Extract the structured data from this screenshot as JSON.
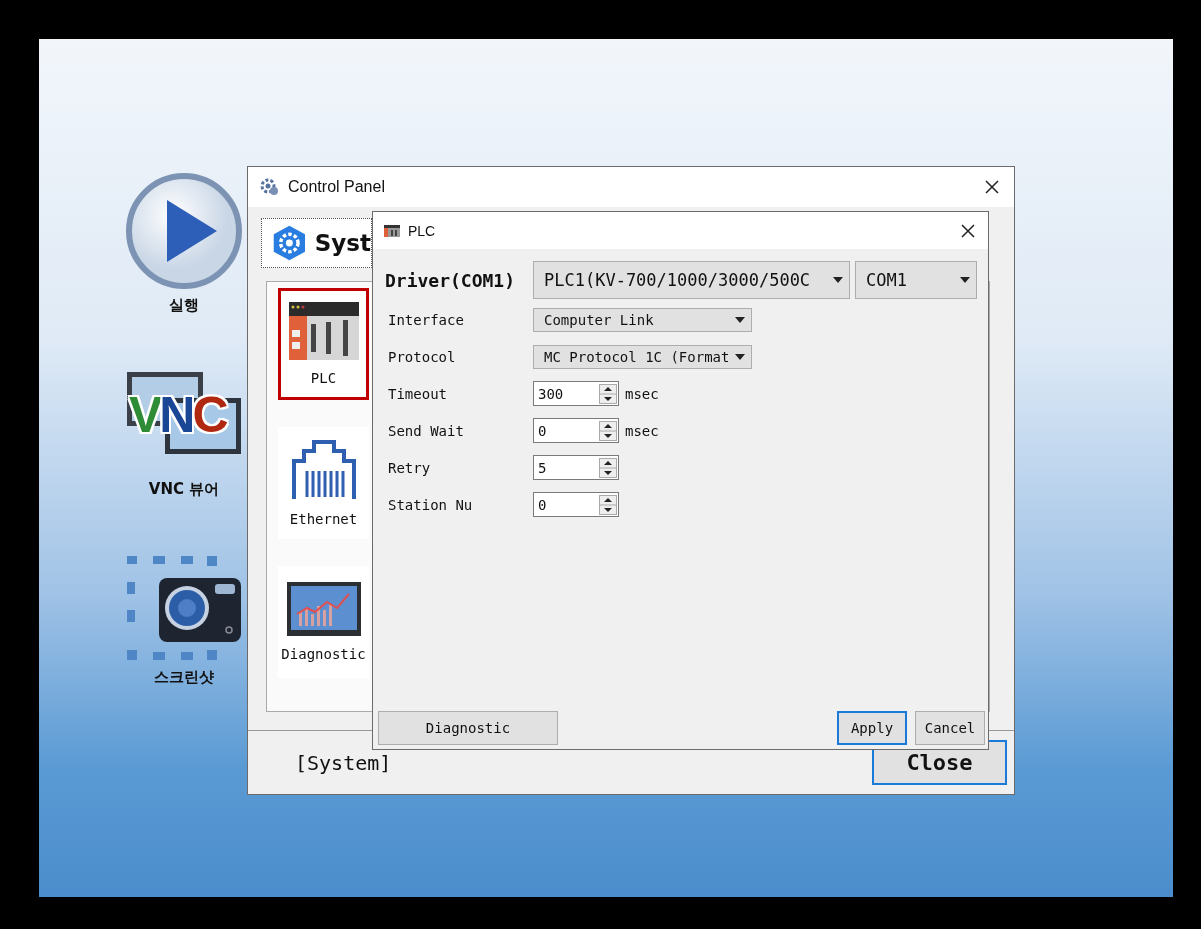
{
  "desktop_icons": [
    {
      "kind": "play",
      "label": "실행"
    },
    {
      "kind": "vnc",
      "label": "VNC 뷰어",
      "logo_text": "VNC"
    },
    {
      "kind": "camera",
      "label": "스크린샷"
    }
  ],
  "control_panel": {
    "title": "Control Panel",
    "tab": {
      "label": "Syst",
      "selected": true
    },
    "items": [
      {
        "kind": "plc",
        "label": "PLC",
        "selected": true
      },
      {
        "kind": "ethernet",
        "label": "Ethernet",
        "selected": false
      },
      {
        "kind": "diagnostic",
        "label": "Diagnostic",
        "selected": false
      }
    ],
    "status": "[System]",
    "close_button": "Close"
  },
  "plc_dialog": {
    "title": "PLC",
    "driver_label": "Driver(COM1)",
    "driver_value": "PLC1(KV-700/1000/3000/500C",
    "port_value": "COM1",
    "fields": [
      {
        "kind": "dropdown",
        "label": "Interface",
        "value": "Computer Link"
      },
      {
        "kind": "dropdown",
        "label": "Protocol",
        "value": "MC Protocol 1C (Format"
      },
      {
        "kind": "spin",
        "label": "Timeout",
        "value": "300",
        "unit": "msec"
      },
      {
        "kind": "spin",
        "label": "Send Wait",
        "value": "0",
        "unit": "msec"
      },
      {
        "kind": "spin",
        "label": "Retry",
        "value": "5"
      },
      {
        "kind": "spin",
        "label": "Station Nu",
        "value": "0"
      }
    ],
    "buttons": [
      {
        "kind": "left",
        "label": "Diagnostic",
        "default": false
      },
      {
        "kind": "right",
        "label": "Apply",
        "default": true
      },
      {
        "kind": "right",
        "label": "Cancel",
        "default": false
      }
    ]
  }
}
